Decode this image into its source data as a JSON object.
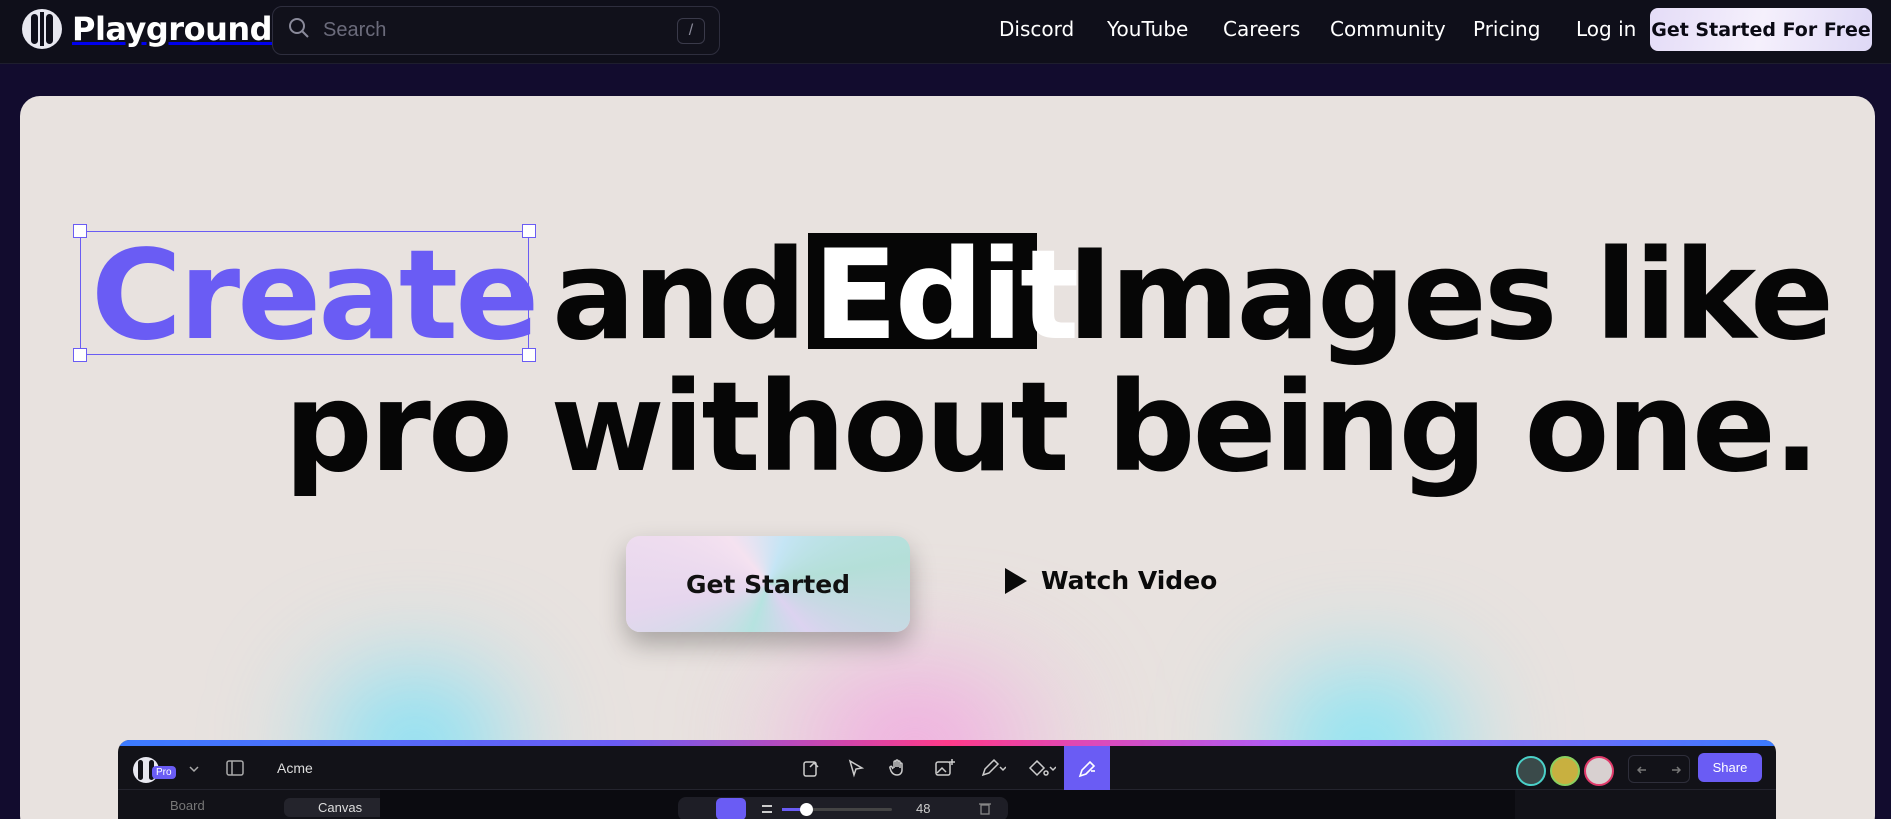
{
  "header": {
    "brand": "Playground",
    "search": {
      "placeholder": "Search",
      "shortcut": "/"
    },
    "nav": [
      {
        "label": "Discord"
      },
      {
        "label": "YouTube"
      },
      {
        "label": "Careers"
      },
      {
        "label": "Community"
      },
      {
        "label": "Pricing"
      },
      {
        "label": "Log in"
      }
    ],
    "cta_label": "Get Started For Free"
  },
  "hero": {
    "headline": {
      "word_create": "Create",
      "word_and": "and",
      "word_edit": "Edit",
      "rest_line1": "Images like a",
      "line2": "pro without being one."
    },
    "primary_cta": "Get Started",
    "secondary_cta": "Watch Video",
    "accent_color": "#6a5cf4"
  },
  "app_preview": {
    "badge": "Pro",
    "workspace": "Acme",
    "share_label": "Share",
    "zoom_value": "48",
    "tabs": [
      "Board",
      "Canvas"
    ]
  }
}
